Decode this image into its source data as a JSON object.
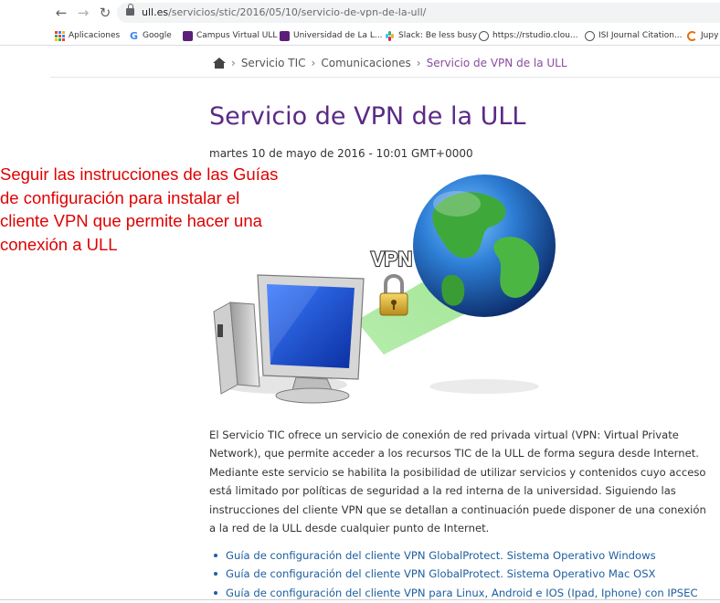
{
  "browser": {
    "url_host": "ull.es",
    "url_path": "/servicios/stic/2016/05/10/servicio-de-vpn-de-la-ull/",
    "bookmarks": [
      {
        "label": "Aplicaciones",
        "icon": "apps-grid-icon"
      },
      {
        "label": "Google",
        "icon": "google-icon"
      },
      {
        "label": "Campus Virtual ULL",
        "icon": "ull-icon"
      },
      {
        "label": "Universidad de La L...",
        "icon": "ull-icon"
      },
      {
        "label": "Slack: Be less busy",
        "icon": "slack-icon"
      },
      {
        "label": "https://rstudio.clou...",
        "icon": "globe-icon"
      },
      {
        "label": "ISI Journal Citation...",
        "icon": "globe-icon"
      },
      {
        "label": "Jupy",
        "icon": "jupyter-icon"
      }
    ]
  },
  "breadcrumb": {
    "items": [
      "Servicio TIC",
      "Comunicaciones"
    ],
    "current": "Servicio de VPN de la ULL",
    "separator": "›"
  },
  "article": {
    "title": "Servicio de VPN de la ULL",
    "date": "martes 10 de mayo de 2016 - 10:01 GMT+0000",
    "illustration_label": "VPN",
    "body_lines": [
      "El Servicio TIC ofrece un servicio de conexión de red privada virtual (VPN: Virtual Private",
      "Network), que permite acceder a los recursos TIC de la ULL de forma segura desde Internet.",
      "Mediante este servicio se habilita la posibilidad de utilizar servicios y contenidos cuyo acceso",
      "está limitado por políticas de seguridad a la red interna de la universidad. Siguiendo las",
      "instrucciones del cliente VPN que se detallan a continuación puede disponer de una conexión",
      "a la red de la ULL desde cualquier punto de Internet."
    ],
    "guides": [
      "Guía de configuración del cliente VPN GlobalProtect. Sistema Operativo Windows",
      "Guía de configuración del cliente VPN GlobalProtect. Sistema Operativo Mac OSX",
      "Guía de configuración del cliente VPN para Linux, Android e IOS (Ipad, Iphone) con IPSEC"
    ]
  },
  "annotation": {
    "lines": [
      "Seguir las instrucciones de las Guías",
      "de configuración para instalar el",
      "cliente VPN que permite hacer una",
      "conexión a ULL"
    ]
  },
  "colors": {
    "title": "#5b2a86",
    "breadcrumb_current": "#8a4b9e",
    "annotation": "#e00000",
    "link": "#1e5fa0"
  }
}
